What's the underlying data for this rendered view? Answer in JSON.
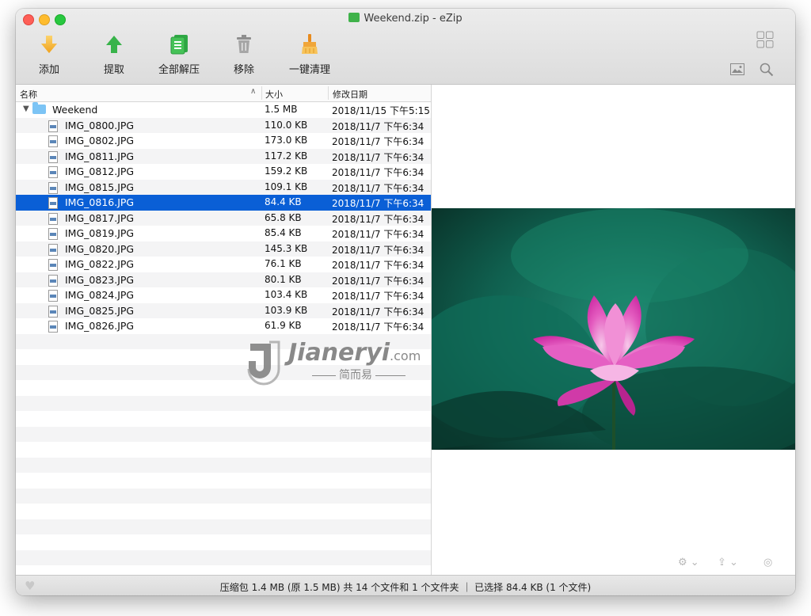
{
  "window": {
    "title": "Weekend.zip - eZip"
  },
  "toolbar": {
    "add": "添加",
    "extract": "提取",
    "extract_all": "全部解压",
    "remove": "移除",
    "clean": "一键清理"
  },
  "columns": {
    "name": "名称",
    "size": "大小",
    "date": "修改日期"
  },
  "folder": {
    "name": "Weekend",
    "size": "1.5 MB",
    "date": "2018/11/15 下午5:15"
  },
  "files": [
    {
      "name": "IMG_0800.JPG",
      "size": "110.0 KB",
      "date": "2018/11/7 下午6:34"
    },
    {
      "name": "IMG_0802.JPG",
      "size": "173.0 KB",
      "date": "2018/11/7 下午6:34"
    },
    {
      "name": "IMG_0811.JPG",
      "size": "117.2 KB",
      "date": "2018/11/7 下午6:34"
    },
    {
      "name": "IMG_0812.JPG",
      "size": "159.2 KB",
      "date": "2018/11/7 下午6:34"
    },
    {
      "name": "IMG_0815.JPG",
      "size": "109.1 KB",
      "date": "2018/11/7 下午6:34"
    },
    {
      "name": "IMG_0816.JPG",
      "size": "84.4 KB",
      "date": "2018/11/7 下午6:34"
    },
    {
      "name": "IMG_0817.JPG",
      "size": "65.8 KB",
      "date": "2018/11/7 下午6:34"
    },
    {
      "name": "IMG_0819.JPG",
      "size": "85.4 KB",
      "date": "2018/11/7 下午6:34"
    },
    {
      "name": "IMG_0820.JPG",
      "size": "145.3 KB",
      "date": "2018/11/7 下午6:34"
    },
    {
      "name": "IMG_0822.JPG",
      "size": "76.1 KB",
      "date": "2018/11/7 下午6:34"
    },
    {
      "name": "IMG_0823.JPG",
      "size": "80.1 KB",
      "date": "2018/11/7 下午6:34"
    },
    {
      "name": "IMG_0824.JPG",
      "size": "103.4 KB",
      "date": "2018/11/7 下午6:34"
    },
    {
      "name": "IMG_0825.JPG",
      "size": "103.9 KB",
      "date": "2018/11/7 下午6:34"
    },
    {
      "name": "IMG_0826.JPG",
      "size": "61.9 KB",
      "date": "2018/11/7 下午6:34"
    }
  ],
  "selected_file": "IMG_0816.JPG",
  "status": {
    "text": "压缩包 1.4 MB (原 1.5 MB) 共 14 个文件和 1 个文件夹 ｜ 已选择 84.4 KB (1 个文件)"
  },
  "watermark": {
    "brand": "Jianeryi",
    "suffix": ".com",
    "tagline": "简而易"
  },
  "colors": {
    "selection": "#0a5fd6",
    "accent_green": "#3fb24a",
    "accent_orange": "#f5a623"
  }
}
